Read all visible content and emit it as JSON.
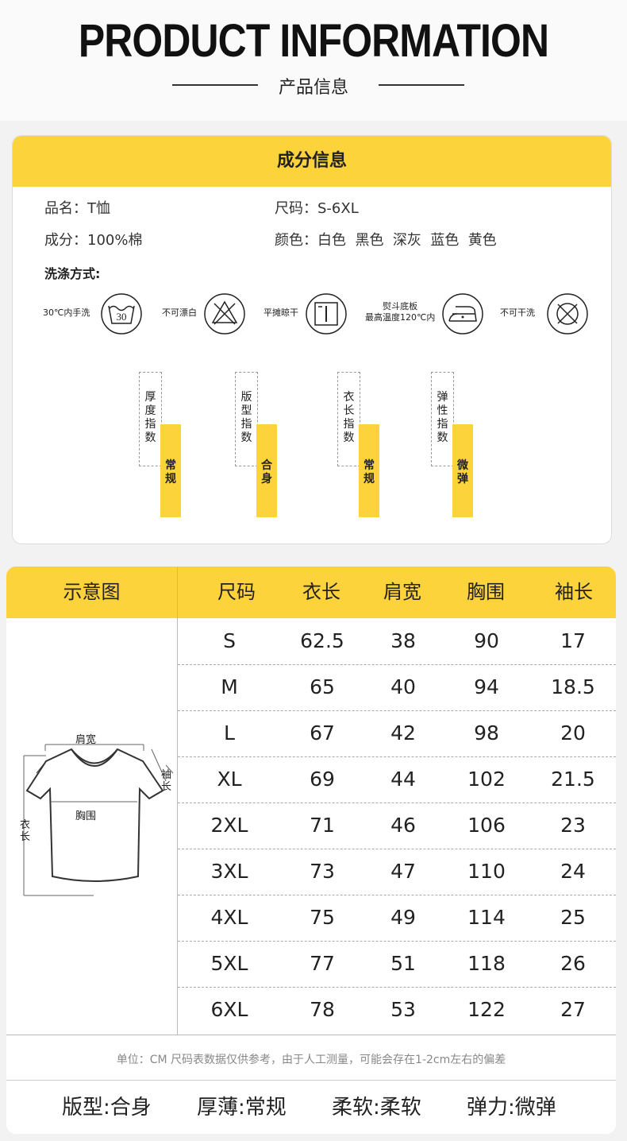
{
  "header": {
    "title": "PRODUCT INFORMATION",
    "subtitle": "产品信息"
  },
  "composition": {
    "heading": "成分信息",
    "name": "品名：T恤",
    "size": "尺码：S-6XL",
    "material": "成分：100%棉",
    "colors": "颜色：白色  黑色  深灰  蓝色  黄色",
    "wash_title": "洗涤方式:",
    "wash": [
      {
        "label": "30℃内手洗",
        "icon": "hand-wash-30-icon",
        "num": "30"
      },
      {
        "label": "不可漂白",
        "icon": "no-bleach-icon"
      },
      {
        "label": "平摊晾干",
        "icon": "dry-flat-icon"
      },
      {
        "label1": "熨斗底板",
        "label2": "最高温度120℃内",
        "icon": "iron-120-icon"
      },
      {
        "label": "不可干洗",
        "icon": "no-dry-clean-icon"
      }
    ],
    "indices": [
      {
        "label": "厚度指数",
        "value": "常规"
      },
      {
        "label": "版型指数",
        "value": "合身"
      },
      {
        "label": "衣长指数",
        "value": "常规"
      },
      {
        "label": "弹性指数",
        "value": "微弹"
      }
    ]
  },
  "size_table": {
    "diagram_header": "示意图",
    "headers": [
      "尺码",
      "衣长",
      "肩宽",
      "胸围",
      "袖长"
    ],
    "rows": [
      [
        "S",
        "62.5",
        "38",
        "90",
        "17"
      ],
      [
        "M",
        "65",
        "40",
        "94",
        "18.5"
      ],
      [
        "L",
        "67",
        "42",
        "98",
        "20"
      ],
      [
        "XL",
        "69",
        "44",
        "102",
        "21.5"
      ],
      [
        "2XL",
        "71",
        "46",
        "106",
        "23"
      ],
      [
        "3XL",
        "73",
        "47",
        "110",
        "24"
      ],
      [
        "4XL",
        "75",
        "49",
        "114",
        "25"
      ],
      [
        "5XL",
        "77",
        "51",
        "118",
        "26"
      ],
      [
        "6XL",
        "78",
        "53",
        "122",
        "27"
      ]
    ],
    "diagram_labels": {
      "shoulder": "肩宽",
      "sleeve": "袖长",
      "chest": "胸围",
      "length": "衣长"
    },
    "note": "单位：CM 尺码表数据仅供参考，由于人工测量，可能会存在1-2cm左右的偏差",
    "features": [
      "版型:合身",
      "厚薄:常规",
      "柔软:柔软",
      "弹力:微弹"
    ]
  }
}
